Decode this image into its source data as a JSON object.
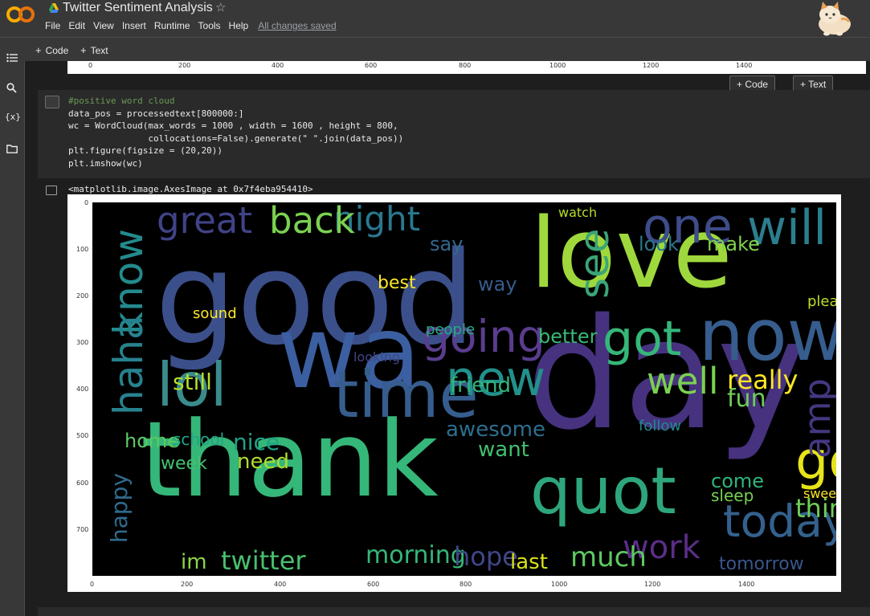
{
  "app": {
    "title": "Twitter Sentiment Analysis",
    "saved_status": "All changes saved",
    "menu": [
      "File",
      "Edit",
      "View",
      "Insert",
      "Runtime",
      "Tools",
      "Help"
    ]
  },
  "toolbar": {
    "code_label": "Code",
    "text_label": "Text"
  },
  "cell_actions": {
    "code_label": "Code",
    "text_label": "Text"
  },
  "code_cell": {
    "lines": [
      "#positive word cloud",
      "data_pos = processedtext[800000:]",
      "wc = WordCloud(max_words = 1000 , width = 1600 , height = 800,",
      "               collocations=False).generate(\" \".join(data_pos))",
      "plt.figure(figsize = (20,20))",
      "plt.imshow(wc)"
    ]
  },
  "output": {
    "text": "<matplotlib.image.AxesImage at 0x7f4eba954410>"
  },
  "prev_output_ticks": [
    "0",
    "200",
    "400",
    "600",
    "800",
    "1000",
    "1200",
    "1400"
  ],
  "wordcloud": {
    "x_ticks": [
      "0",
      "200",
      "400",
      "600",
      "800",
      "1000",
      "1200",
      "1400"
    ],
    "y_ticks": [
      "0",
      "100",
      "200",
      "300",
      "400",
      "500",
      "600",
      "700"
    ],
    "words": [
      {
        "text": "good",
        "color": "#3b4f8a"
      },
      {
        "text": "love",
        "color": "#9fd83c"
      },
      {
        "text": "day",
        "color": "#46327e"
      },
      {
        "text": "thank",
        "color": "#35b779"
      },
      {
        "text": "wa",
        "color": "#3b5fa0"
      },
      {
        "text": "now",
        "color": "#365d8d"
      },
      {
        "text": "time",
        "color": "#365d8d"
      },
      {
        "text": "quot",
        "color": "#2ea67b"
      },
      {
        "text": "lol",
        "color": "#3a8c8c"
      },
      {
        "text": "going",
        "color": "#5a3d8e"
      },
      {
        "text": "new",
        "color": "#21918c"
      },
      {
        "text": "got",
        "color": "#35b779"
      },
      {
        "text": "today",
        "color": "#34618d"
      },
      {
        "text": "will",
        "color": "#2c7e8e"
      },
      {
        "text": "one",
        "color": "#3e4c8a"
      },
      {
        "text": "see",
        "color": "#3aa577"
      },
      {
        "text": "go",
        "color": "#e6e419"
      },
      {
        "text": "night",
        "color": "#2a788e"
      },
      {
        "text": "great",
        "color": "#404387"
      },
      {
        "text": "back",
        "color": "#7ad151"
      },
      {
        "text": "know",
        "color": "#238a8d"
      },
      {
        "text": "well",
        "color": "#7ad151"
      },
      {
        "text": "work",
        "color": "#5b2e88"
      },
      {
        "text": "really",
        "color": "#fde725"
      },
      {
        "text": "morning",
        "color": "#35b779"
      },
      {
        "text": "twitter",
        "color": "#48c16e"
      },
      {
        "text": "much",
        "color": "#5ec962"
      },
      {
        "text": "think",
        "color": "#6ece58"
      },
      {
        "text": "hope",
        "color": "#3f4788"
      },
      {
        "text": "fun",
        "color": "#6ece58"
      },
      {
        "text": "still",
        "color": "#b5de2b"
      },
      {
        "text": "haha",
        "color": "#26828e"
      },
      {
        "text": "amp",
        "color": "#453781"
      },
      {
        "text": "friend",
        "color": "#31b57b"
      },
      {
        "text": "awesome",
        "color": "#2e6e8e"
      },
      {
        "text": "nice",
        "color": "#1fa187"
      },
      {
        "text": "home",
        "color": "#5ec962"
      },
      {
        "text": "need",
        "color": "#addc30"
      },
      {
        "text": "want",
        "color": "#42be71"
      },
      {
        "text": "tomorrow",
        "color": "#39568c"
      },
      {
        "text": "best",
        "color": "#fde725"
      },
      {
        "text": "make",
        "color": "#7fd34e"
      },
      {
        "text": "look",
        "color": "#2a788e"
      },
      {
        "text": "say",
        "color": "#31688e"
      },
      {
        "text": "happy",
        "color": "#2f6b8e"
      },
      {
        "text": "last",
        "color": "#d8e219"
      },
      {
        "text": "week",
        "color": "#46c06f"
      },
      {
        "text": "watch",
        "color": "#b8de29"
      },
      {
        "text": "im",
        "color": "#8bd646"
      },
      {
        "text": "better",
        "color": "#38b977"
      },
      {
        "text": "sound",
        "color": "#fde725"
      },
      {
        "text": "way",
        "color": "#365c8d"
      },
      {
        "text": "school",
        "color": "#20a486"
      },
      {
        "text": "please",
        "color": "#bddf26"
      },
      {
        "text": "come",
        "color": "#2fb47c"
      },
      {
        "text": "sleep",
        "color": "#77d153"
      },
      {
        "text": "people",
        "color": "#25ac82"
      },
      {
        "text": "looking",
        "color": "#414487"
      },
      {
        "text": "follow",
        "color": "#23898e"
      },
      {
        "text": "sweet",
        "color": "#fde725"
      }
    ]
  }
}
